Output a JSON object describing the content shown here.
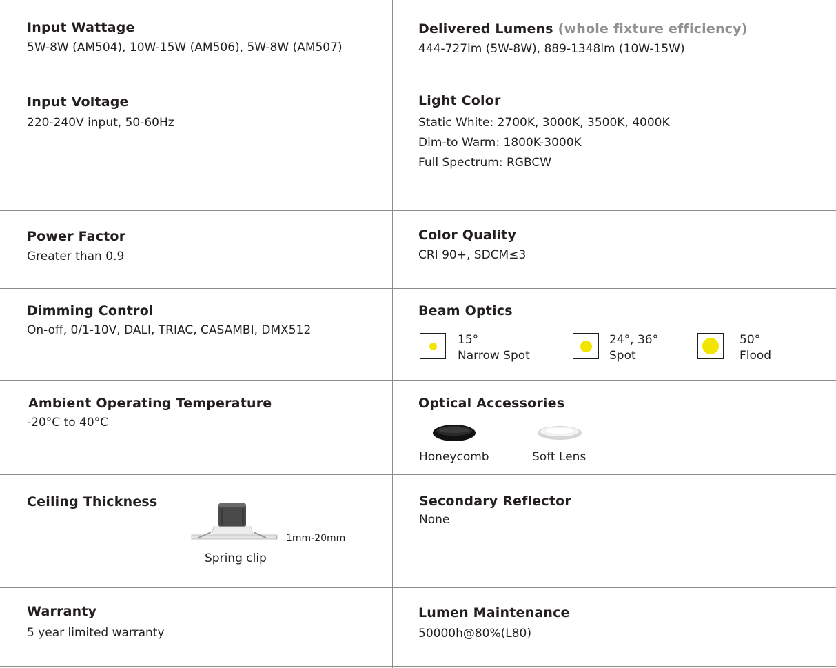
{
  "specs": {
    "input_wattage": {
      "title": "Input Wattage",
      "value": "5W-8W (AM504), 10W-15W (AM506), 5W-8W (AM507)"
    },
    "delivered_lumens": {
      "title": "Delivered Lumens",
      "note": "(whole fixture efficiency)",
      "value": "444-727lm (5W-8W), 889-1348lm (10W-15W)"
    },
    "input_voltage": {
      "title": "Input Voltage",
      "value": "220-240V input, 50-60Hz"
    },
    "light_color": {
      "title": "Light Color",
      "lines": [
        "Static White: 2700K, 3000K, 3500K, 4000K",
        "Dim-to Warm: 1800K-3000K",
        "Full Spectrum: RGBCW"
      ]
    },
    "power_factor": {
      "title": "Power Factor",
      "value": "Greater than 0.9"
    },
    "color_quality": {
      "title": "Color Quality",
      "value": "CRI 90+, SDCM≤3"
    },
    "dimming_control": {
      "title": "Dimming Control",
      "value": "On-off, 0/1-10V, DALI, TRIAC, CASAMBI, DMX512"
    },
    "beam_optics": {
      "title": "Beam Optics",
      "options": [
        {
          "angle": "15°",
          "name": "Narrow Spot",
          "dot_size": "small"
        },
        {
          "angle": "24°, 36°",
          "name": "Spot",
          "dot_size": "medium"
        },
        {
          "angle": "50°",
          "name": "Flood",
          "dot_size": "large"
        }
      ],
      "dot_color": "#f2e600"
    },
    "ambient_temp": {
      "title": "Ambient Operating Temperature",
      "value": "-20°C to 40°C"
    },
    "optical_accessories": {
      "title": "Optical Accessories",
      "items": [
        "Honeycomb",
        "Soft Lens"
      ]
    },
    "ceiling_thickness": {
      "title": "Ceiling Thickness",
      "range": "1mm-20mm",
      "caption": "Spring clip"
    },
    "secondary_reflector": {
      "title": "Secondary Reflector",
      "value": "None"
    },
    "warranty": {
      "title": "Warranty",
      "value": "5 year limited warranty"
    },
    "lumen_maintenance": {
      "title": "Lumen Maintenance",
      "value": "50000h@80%(L80)"
    }
  }
}
